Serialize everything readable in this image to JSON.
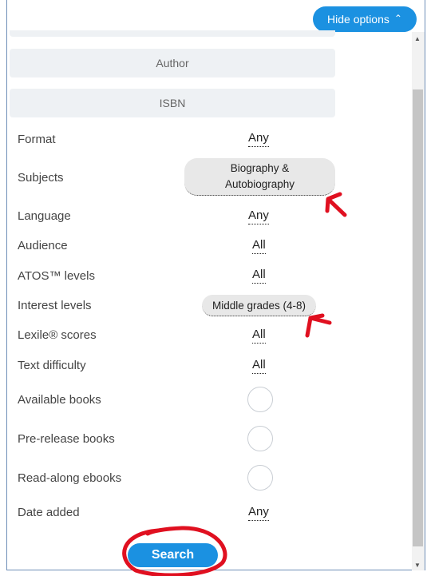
{
  "header": {
    "hide_options_label": "Hide options"
  },
  "fields": {
    "author_label": "Author",
    "isbn_label": "ISBN"
  },
  "options": [
    {
      "label": "Format",
      "value": "Any"
    },
    {
      "label": "Subjects",
      "value": "Biography & Autobiography"
    },
    {
      "label": "Language",
      "value": "Any"
    },
    {
      "label": "Audience",
      "value": "All"
    },
    {
      "label": "ATOS™ levels",
      "value": "All"
    },
    {
      "label": "Interest levels",
      "value": "Middle grades (4-8)"
    },
    {
      "label": "Lexile® scores",
      "value": "All"
    },
    {
      "label": "Text difficulty",
      "value": "All"
    },
    {
      "label": "Available books"
    },
    {
      "label": "Pre-release books"
    },
    {
      "label": "Read-along ebooks"
    },
    {
      "label": "Date added",
      "value": "Any"
    }
  ],
  "subjects_line1": "Biography &",
  "subjects_line2": "Autobiography",
  "search_label": "Search",
  "colors": {
    "accent": "#1b91e1",
    "annotation": "#e01020"
  }
}
